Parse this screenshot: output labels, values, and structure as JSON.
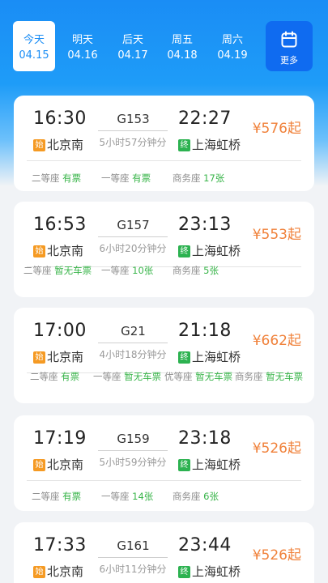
{
  "dates": [
    {
      "weekday": "今天",
      "date": "04.15",
      "active": true
    },
    {
      "weekday": "明天",
      "date": "04.16",
      "active": false
    },
    {
      "weekday": "后天",
      "date": "04.17",
      "active": false
    },
    {
      "weekday": "周五",
      "date": "04.18",
      "active": false
    },
    {
      "weekday": "周六",
      "date": "04.19",
      "active": false
    }
  ],
  "more_label": "更多",
  "colors": {
    "primary": "#1a8df5",
    "price": "#f0813a",
    "available": "#39b54a",
    "start_tag": "#f59a23",
    "end_tag": "#2cb250"
  },
  "trains": [
    {
      "dep_time": "16:30",
      "arr_time": "22:27",
      "train_no": "G153",
      "duration": "5小时57分钟分",
      "start_tag": "始",
      "end_tag": "终",
      "dep_station": "北京南",
      "arr_station": "上海虹桥",
      "price": "¥576起",
      "seats": [
        {
          "name": "二等座",
          "status": "有票"
        },
        {
          "name": "一等座",
          "status": "有票"
        },
        {
          "name": "商务座",
          "status": "17张"
        }
      ]
    },
    {
      "dep_time": "16:53",
      "arr_time": "23:13",
      "train_no": "G157",
      "duration": "6小时20分钟分",
      "start_tag": "始",
      "end_tag": "终",
      "dep_station": "北京南",
      "arr_station": "上海虹桥",
      "price": "¥553起",
      "seats": [
        {
          "name": "二等座",
          "status": "暂无车票"
        },
        {
          "name": "一等座",
          "status": "10张"
        },
        {
          "name": "商务座",
          "status": "5张"
        }
      ]
    },
    {
      "dep_time": "17:00",
      "arr_time": "21:18",
      "train_no": "G21",
      "duration": "4小时18分钟分",
      "start_tag": "始",
      "end_tag": "终",
      "dep_station": "北京南",
      "arr_station": "上海虹桥",
      "price": "¥662起",
      "seats": [
        {
          "name": "二等座",
          "status": "有票"
        },
        {
          "name": "一等座",
          "status": "暂无车票"
        },
        {
          "name": "优等座",
          "status": "暂无车票"
        },
        {
          "name": "商务座",
          "status": "暂无车票"
        }
      ]
    },
    {
      "dep_time": "17:19",
      "arr_time": "23:18",
      "train_no": "G159",
      "duration": "5小时59分钟分",
      "start_tag": "始",
      "end_tag": "终",
      "dep_station": "北京南",
      "arr_station": "上海虹桥",
      "price": "¥526起",
      "seats": [
        {
          "name": "二等座",
          "status": "有票"
        },
        {
          "name": "一等座",
          "status": "14张"
        },
        {
          "name": "商务座",
          "status": "6张"
        }
      ]
    },
    {
      "dep_time": "17:33",
      "arr_time": "23:44",
      "train_no": "G161",
      "duration": "6小时11分钟分",
      "start_tag": "始",
      "end_tag": "终",
      "dep_station": "北京南",
      "arr_station": "上海虹桥",
      "price": "¥526起",
      "seats": []
    }
  ]
}
